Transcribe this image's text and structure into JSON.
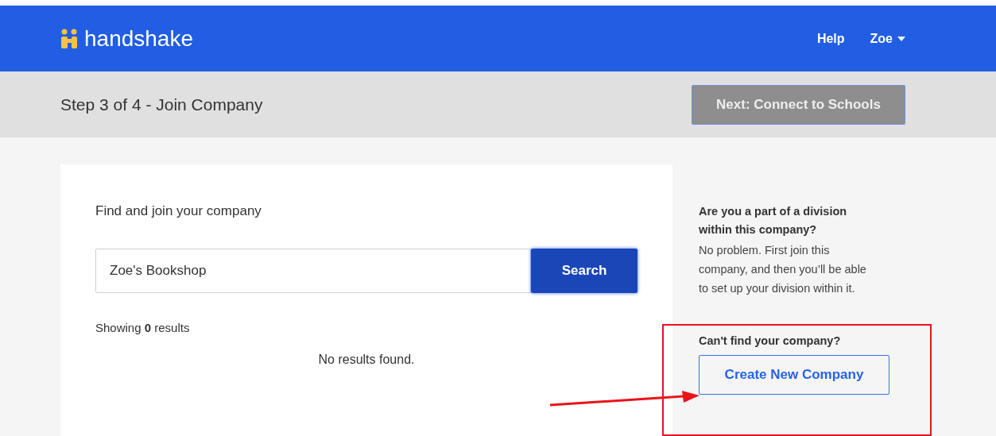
{
  "header": {
    "logo": "handshake",
    "nav": [
      {
        "label": "Help",
        "kind": "link"
      },
      {
        "label": "Zoe",
        "kind": "menu"
      }
    ]
  },
  "step_bar": {
    "title": "Step 3 of 4 - Join Company",
    "next_button": {
      "label": "Next: Connect to Schools",
      "disabled": true
    }
  },
  "search_card": {
    "heading": "Find and join your company",
    "search": {
      "value": "Zoe's Bookshop",
      "button": "Search"
    },
    "results_count": "Showing **0** results",
    "empty_message": "No results found."
  },
  "sidebar": {
    "division_title": "Are you a part of a division within this company?",
    "division_text": "No problem. First join this company, and then you’ll be able to set up your division within it.",
    "cant_find": "Can't find your company?",
    "create_button": "Create New Company"
  }
}
